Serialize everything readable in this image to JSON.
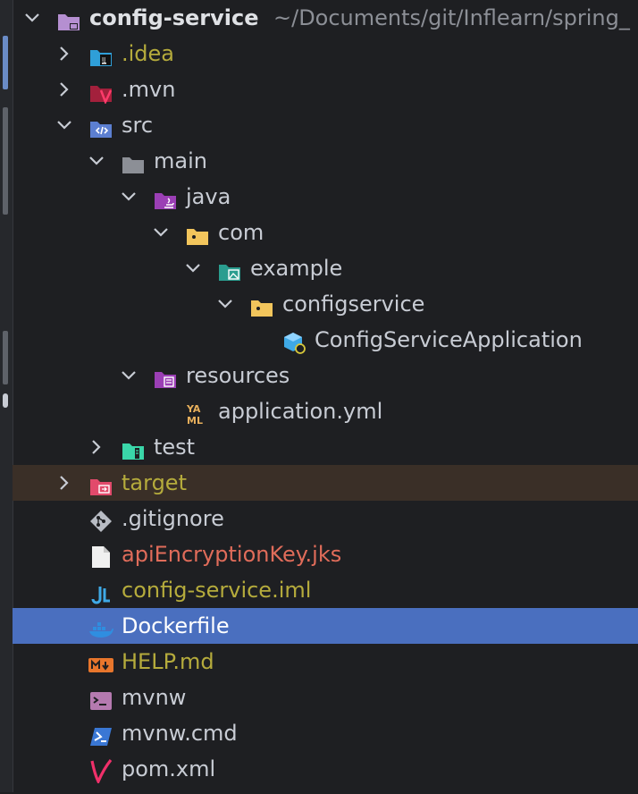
{
  "colors": {
    "background": "#1e1f22",
    "selected_row": "#4a6fbf",
    "excluded_row": "#3a2f27",
    "ignored_text": "#b5ab3c",
    "unversioned_text": "#e06c5a"
  },
  "tree": {
    "root": {
      "label": "config-service",
      "path": "~/Documents/git/Inflearn/spring_",
      "icon": "module-folder-icon"
    },
    "idea": {
      "label": ".idea",
      "icon": "idea-folder-icon"
    },
    "mvn": {
      "label": ".mvn",
      "icon": "maven-folder-icon"
    },
    "src": {
      "label": "src",
      "icon": "source-folder-icon"
    },
    "main": {
      "label": "main",
      "icon": "folder-icon"
    },
    "java": {
      "label": "java",
      "icon": "java-source-root-icon"
    },
    "com": {
      "label": "com",
      "icon": "package-icon"
    },
    "example": {
      "label": "example",
      "icon": "package-image-icon"
    },
    "configservice": {
      "label": "configservice",
      "icon": "package-icon"
    },
    "app_class": {
      "label": "ConfigServiceApplication",
      "icon": "spring-boot-class-icon"
    },
    "resources": {
      "label": "resources",
      "icon": "resources-root-icon"
    },
    "application_yml": {
      "label": "application.yml",
      "icon": "yaml-icon"
    },
    "test": {
      "label": "test",
      "icon": "test-folder-icon"
    },
    "target": {
      "label": "target",
      "icon": "excluded-folder-icon"
    },
    "gitignore": {
      "label": ".gitignore",
      "icon": "git-icon"
    },
    "jks": {
      "label": "apiEncryptionKey.jks",
      "icon": "file-icon"
    },
    "iml": {
      "label": "config-service.iml",
      "icon": "intellij-module-icon"
    },
    "dockerfile": {
      "label": "Dockerfile",
      "icon": "docker-icon"
    },
    "help_md": {
      "label": "HELP.md",
      "icon": "markdown-icon"
    },
    "mvnw": {
      "label": "mvnw",
      "icon": "shell-script-icon"
    },
    "mvnw_cmd": {
      "label": "mvnw.cmd",
      "icon": "powershell-icon"
    },
    "pom": {
      "label": "pom.xml",
      "icon": "maven-pom-icon"
    }
  }
}
